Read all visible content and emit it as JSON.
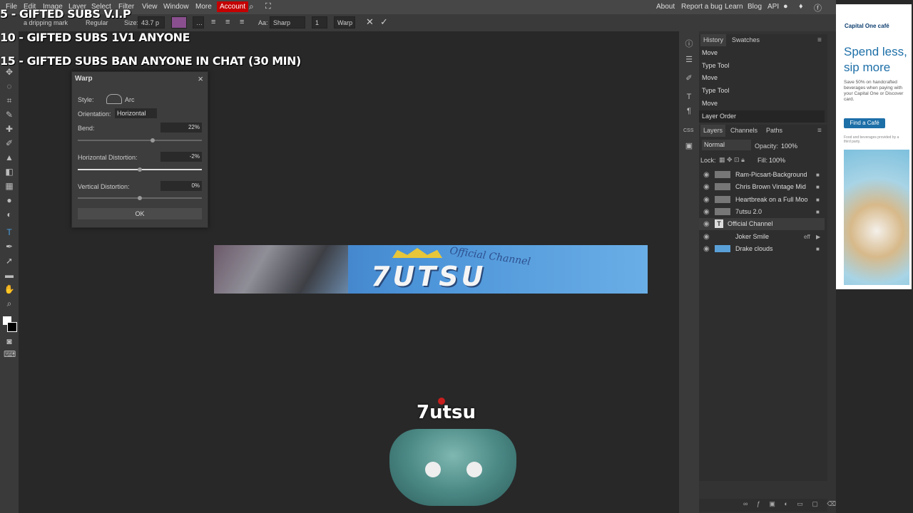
{
  "menubar": {
    "items": [
      "File",
      "Edit",
      "Image",
      "Layer",
      "Select",
      "Filter",
      "View",
      "Window",
      "More"
    ],
    "account": "Account",
    "right_links": [
      "About",
      "Report a bug",
      "Learn",
      "Blog",
      "API"
    ]
  },
  "options": {
    "font": "a dripping mark",
    "style": "Regular",
    "size_label": "Size:",
    "size_value": "43.7 p",
    "aa_label": "Aa:",
    "aa_value": "Sharp",
    "spacing": "1",
    "warp_button": "Warp"
  },
  "overlay": {
    "line1": "5 - GIFTED SUBS V.I.P",
    "line2": "10 - GIFTED SUBS 1V1 ANYONE",
    "line3": "15 - GIFTED SUBS BAN ANYONE IN CHAT (30 MIN)"
  },
  "warp": {
    "title": "Warp",
    "style_label": "Style:",
    "style_value": "Arc",
    "orientation_label": "Orientation:",
    "orientation_value": "Horizontal",
    "bend_label": "Bend:",
    "bend_value": "22%",
    "hdist_label": "Horizontal Distortion:",
    "hdist_value": "-2%",
    "vdist_label": "Vertical Distortion:",
    "vdist_value": "0%",
    "ok": "OK"
  },
  "canvas": {
    "banner_logo": "7UTSU",
    "banner_script": "Official Channel",
    "ctrl_name": "7utsu"
  },
  "history": {
    "tabs": [
      "History",
      "Swatches"
    ],
    "rows": [
      "Move",
      "Type Tool",
      "Move",
      "Type Tool",
      "Move",
      "Layer Order"
    ]
  },
  "layers": {
    "tabs": [
      "Layers",
      "Channels",
      "Paths"
    ],
    "blend": "Normal",
    "opacity_label": "Opacity:",
    "opacity_value": "100%",
    "lock_label": "Lock:",
    "fill_label": "Fill:",
    "fill_value": "100%",
    "rows": [
      {
        "name": "Ram-Picsart-Background"
      },
      {
        "name": "Chris Brown Vintage Mid"
      },
      {
        "name": "Heartbreak on a Full Moo"
      },
      {
        "name": "7utsu 2.0"
      },
      {
        "name": "Official Channel"
      },
      {
        "name": "Joker Smile"
      },
      {
        "name": "Drake clouds"
      }
    ],
    "eff": "eff"
  },
  "ad": {
    "brand": "Capital One café",
    "headline": "Spend less, sip more",
    "body": "Save 50% on handcrafted beverages when paying with your Capital One or Discover card.",
    "button": "Find a Café",
    "fine": "Food and beverages provided by a third party."
  }
}
